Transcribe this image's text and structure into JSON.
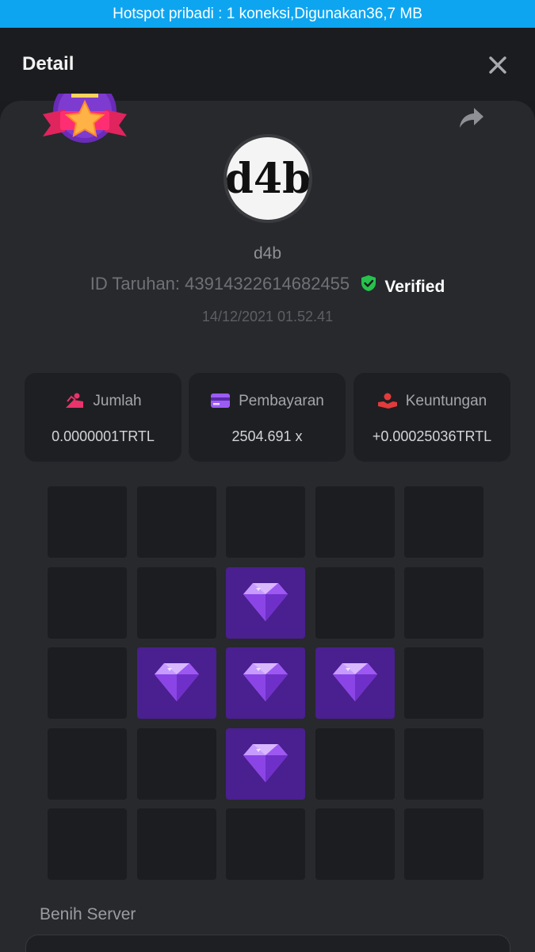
{
  "status_bar": {
    "hotspot_text": "Hotspot pribadi : 1 koneksi,Digunakan36,7 MB"
  },
  "header": {
    "title": "Detail",
    "close_icon": "close-icon"
  },
  "bet": {
    "badge_icon": "win-star-badge-icon",
    "share_icon": "share-icon",
    "avatar_text": "d4b",
    "username": "d4b",
    "bet_id_label": "ID Taruhan: 43914322614682455",
    "verified_label": "Verified",
    "timestamp": "14/12/2021 01.52.41"
  },
  "stats": [
    {
      "label": "Jumlah",
      "value": "0.0000001TRTL",
      "icon": "coins-icon"
    },
    {
      "label": "Pembayaran",
      "value": "2504.691 x",
      "icon": "card-icon"
    },
    {
      "label": "Keuntungan",
      "value": "+0.00025036TRTL",
      "icon": "hand-profit-icon"
    }
  ],
  "board": {
    "rows": [
      [
        "empty",
        "empty",
        "empty",
        "empty",
        "empty"
      ],
      [
        "empty",
        "empty",
        "gem",
        "empty",
        "empty"
      ],
      [
        "empty",
        "gem",
        "gem",
        "gem",
        "empty"
      ],
      [
        "empty",
        "empty",
        "gem",
        "empty",
        "empty"
      ],
      [
        "empty",
        "empty",
        "empty",
        "empty",
        "empty"
      ]
    ]
  },
  "server_seed": {
    "label": "Benih Server",
    "value": ""
  },
  "colors": {
    "hotspot_bar": "#0ea5f0",
    "gem_tile": "#4a1f8f",
    "verified_green": "#27c24c"
  }
}
